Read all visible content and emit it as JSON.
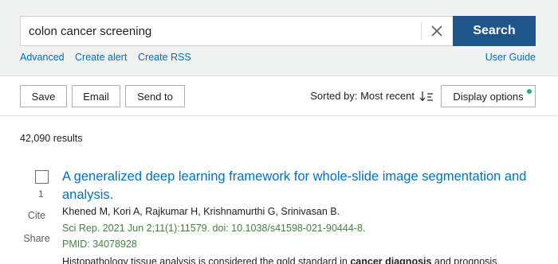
{
  "search": {
    "query": "colon cancer screening",
    "button_label": "Search"
  },
  "links": {
    "advanced": "Advanced",
    "create_alert": "Create alert",
    "create_rss": "Create RSS",
    "user_guide": "User Guide"
  },
  "toolbar": {
    "save": "Save",
    "email": "Email",
    "send_to": "Send to",
    "sorted_by": "Sorted by: Most recent",
    "display_options": "Display options",
    "display_dot_color": "#21b27a"
  },
  "results": {
    "count": "42,090 results",
    "items": [
      {
        "number": "1",
        "cite": "Cite",
        "share": "Share",
        "title": "A generalized deep learning framework for whole-slide image segmentation and analysis.",
        "authors": "Khened M, Kori A, Rajkumar H, Krishnamurthi G, Srinivasan B.",
        "citation": "Sci Rep. 2021 Jun 2;11(1):11579. doi: 10.1038/s41598-021-90444-8.",
        "pmid": "PMID: 34078928",
        "snippet_before": "Histopathology tissue analysis is considered the gold standard in ",
        "snippet_bold": "cancer diagnosis",
        "snippet_after": " and prognosis."
      }
    ]
  },
  "colors": {
    "primary_button": "#20558a",
    "link": "#0071bc",
    "citation_green": "#42813f"
  }
}
